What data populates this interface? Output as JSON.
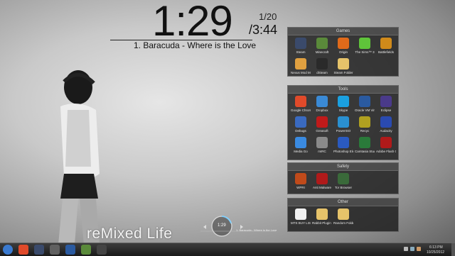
{
  "clock": {
    "time": "1:29"
  },
  "track": {
    "position": "1/20",
    "length": "/3:44",
    "title": "1. Baracuda - Where is the Love"
  },
  "wallpaper": {
    "caption": "reMixed Life"
  },
  "player": {
    "time": "1:29",
    "title": "1. Baracuda - Where is the Love"
  },
  "fences": {
    "games": {
      "title": "Games",
      "items": [
        {
          "label": "Steam",
          "color": "#3a4a6b",
          "icon": "steam-icon"
        },
        {
          "label": "Minecraft",
          "color": "#5a8a3a",
          "icon": "minecraft-icon"
        },
        {
          "label": "Origin",
          "color": "#e06a1a",
          "icon": "origin-icon"
        },
        {
          "label": "The Sims™ 3",
          "color": "#5fc43a",
          "icon": "sims-icon"
        },
        {
          "label": "Battlefields",
          "color": "#d08a1a",
          "icon": "battlefield-icon"
        },
        {
          "label": "Nexus Mod Manager",
          "color": "#e0a040",
          "icon": "nexus-icon"
        },
        {
          "label": "dSteam",
          "color": "#2a2a2a",
          "icon": "dsteam-icon"
        },
        {
          "label": "Steam Folder",
          "color": "#e6c36a",
          "icon": "folder-icon"
        }
      ]
    },
    "tools": {
      "title": "Tools",
      "items": [
        {
          "label": "Google Chrome",
          "color": "#e04a2a",
          "icon": "chrome-icon"
        },
        {
          "label": "Dropbox",
          "color": "#3a8ad6",
          "icon": "dropbox-icon"
        },
        {
          "label": "Skype",
          "color": "#1aa0e0",
          "icon": "skype-icon"
        },
        {
          "label": "Oracle VM VirtualBox",
          "color": "#2a5aa0",
          "icon": "virtualbox-icon"
        },
        {
          "label": "Eclipse",
          "color": "#4a3a8a",
          "icon": "eclipse-icon"
        },
        {
          "label": "Debugs",
          "color": "#3a6ac0",
          "icon": "debug-icon"
        },
        {
          "label": "Greasoft",
          "color": "#c01a1a",
          "icon": "greasoft-icon"
        },
        {
          "label": "PowerISO",
          "color": "#2a90d0",
          "icon": "poweriso-icon"
        },
        {
          "label": "Recyc",
          "color": "#b0a020",
          "icon": "recyc-icon"
        },
        {
          "label": "Audacity",
          "color": "#2a4ab0",
          "icon": "audacity-icon"
        },
        {
          "label": "Media Go",
          "color": "#3a8ae0",
          "icon": "mediago-icon"
        },
        {
          "label": "mIRC",
          "color": "#8a8a8a",
          "icon": "mirc-icon"
        },
        {
          "label": "Photoshop Elements 9",
          "color": "#2a5ac0",
          "icon": "photoshop-icon"
        },
        {
          "label": "Camtasia Studio 8",
          "color": "#2a7a3a",
          "icon": "camtasia-icon"
        },
        {
          "label": "Adobe Flash CS6",
          "color": "#b01a1a",
          "icon": "flash-icon"
        }
      ]
    },
    "safety": {
      "title": "Safety",
      "items": [
        {
          "label": "WPRI",
          "color": "#c04a1a",
          "icon": "shield-icon"
        },
        {
          "label": "Anti Malware",
          "color": "#b01a1a",
          "icon": "malware-icon"
        },
        {
          "label": "Tor Browser",
          "color": "#3a6a3a",
          "icon": "tor-icon"
        }
      ]
    },
    "other": {
      "title": "Other",
      "items": [
        {
          "label": "MTS BUY LIST",
          "color": "#f0f0f0",
          "icon": "document-icon"
        },
        {
          "label": "Rabbit Plugin Making",
          "color": "#e6c36a",
          "icon": "folder-icon"
        },
        {
          "label": "Random Folders",
          "color": "#e6c36a",
          "icon": "folder-icon"
        }
      ]
    }
  },
  "taskbar": {
    "apps": [
      {
        "color": "#3a7ad0",
        "icon": "start-orb-icon"
      },
      {
        "color": "#e04a2a",
        "icon": "chrome-icon"
      },
      {
        "color": "#3a4a6b",
        "icon": "steam-icon"
      },
      {
        "color": "#606060",
        "icon": "winamp-icon"
      },
      {
        "color": "#2a5aa0",
        "icon": "notepad-icon"
      },
      {
        "color": "#5a8a3a",
        "icon": "minecraft-icon"
      },
      {
        "color": "#444444",
        "icon": "cmd-icon"
      }
    ],
    "time": "6:13 PM",
    "date": "10/25/2012"
  }
}
